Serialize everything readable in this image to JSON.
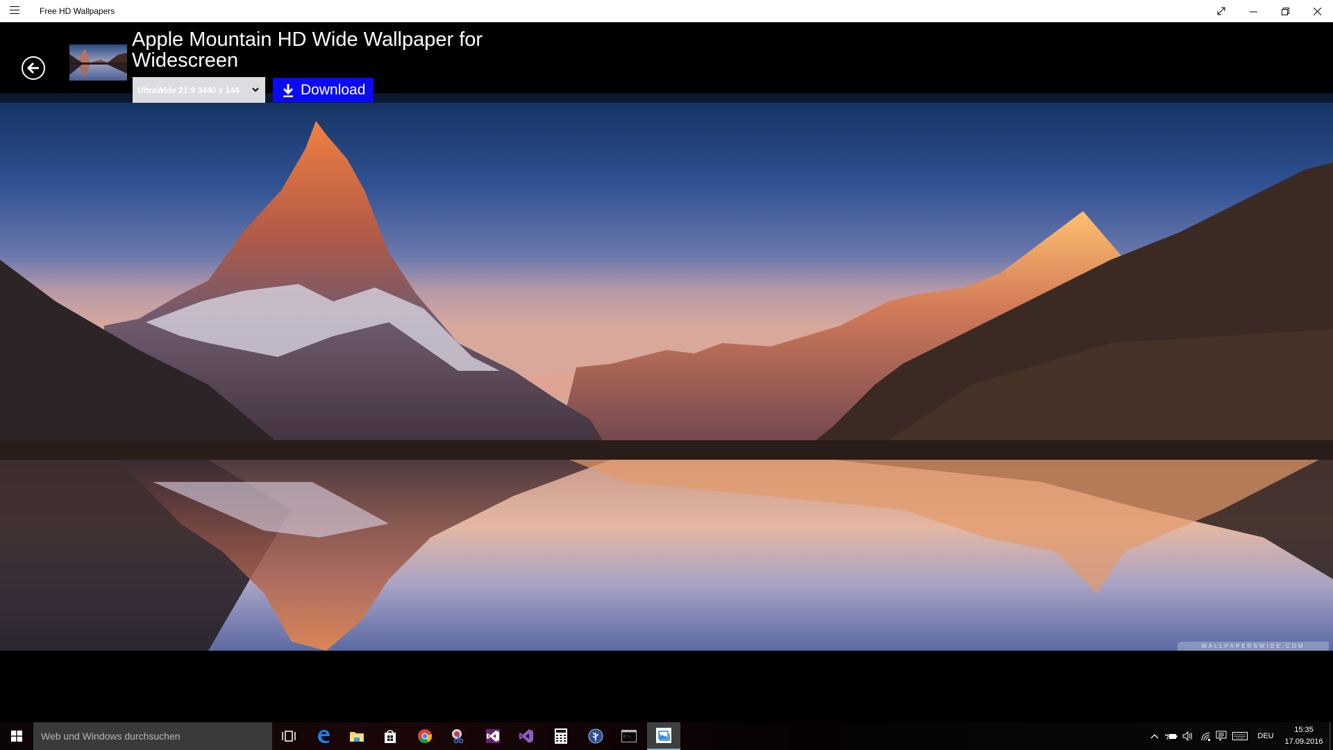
{
  "window": {
    "app_title": "Free HD Wallpapers",
    "controls": {
      "fullscreen": "expand-icon",
      "minimize": "minimize-icon",
      "restore": "restore-icon",
      "close": "close-icon"
    }
  },
  "header": {
    "back_icon": "arrow-left-circle-icon",
    "wallpaper_title": "Apple Mountain HD Wide Wallpaper for Widescreen",
    "resolution_select": {
      "selected": "UltraWide 21:9 3440 x 144"
    },
    "download_label": "Download",
    "download_icon": "download-arrow-icon",
    "accent_color": "#0b0bf2"
  },
  "wallpaper": {
    "description": "Matterhorn mountain at sunrise reflected in a lake",
    "watermark": "WALLPAPERSWIDE.COM"
  },
  "taskbar": {
    "search_placeholder": "Web und Windows durchsuchen",
    "pinned": [
      {
        "name": "task-view",
        "icon": "task-view-icon"
      },
      {
        "name": "edge",
        "icon": "edge-icon"
      },
      {
        "name": "file-explorer",
        "icon": "folder-icon"
      },
      {
        "name": "store",
        "icon": "store-icon"
      },
      {
        "name": "chrome",
        "icon": "chrome-icon"
      },
      {
        "name": "snipping-tool",
        "icon": "scissors-icon"
      },
      {
        "name": "visual-studio",
        "icon": "visual-studio-icon"
      },
      {
        "name": "visual-studio-2",
        "icon": "visual-studio-icon"
      },
      {
        "name": "calculator",
        "icon": "calculator-icon"
      },
      {
        "name": "sourcetree",
        "icon": "sourcetree-icon"
      },
      {
        "name": "command-prompt",
        "icon": "cmd-icon"
      },
      {
        "name": "free-hd-wallpapers",
        "icon": "photos-icon",
        "active": true
      }
    ],
    "tray": {
      "language": "DEU",
      "time": "15:35",
      "date": "17.09.2016"
    }
  }
}
